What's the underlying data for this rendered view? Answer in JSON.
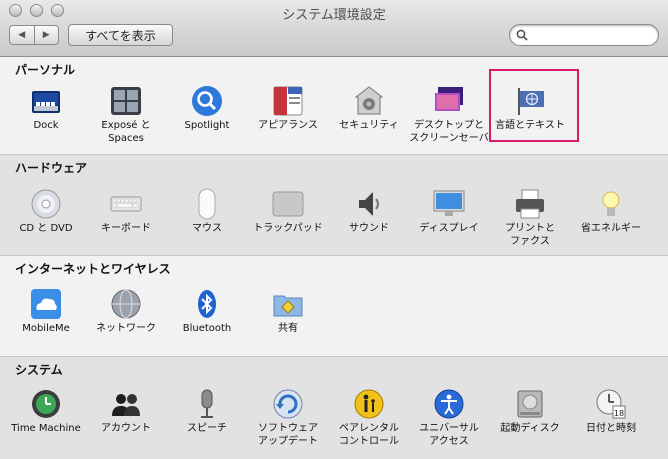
{
  "window": {
    "title": "システム環境設定"
  },
  "toolbar": {
    "back_glyph": "◀",
    "forward_glyph": "▶",
    "show_all": "すべてを表示",
    "search_placeholder": ""
  },
  "sections": {
    "personal": {
      "title": "パーソナル",
      "items": [
        {
          "label": "Dock",
          "icon": "dock-icon"
        },
        {
          "label": "Exposé と\nSpaces",
          "icon": "expose-spaces-icon"
        },
        {
          "label": "Spotlight",
          "icon": "spotlight-icon"
        },
        {
          "label": "アピアランス",
          "icon": "appearance-icon"
        },
        {
          "label": "セキュリティ",
          "icon": "security-icon"
        },
        {
          "label": "デスクトップと\nスクリーンセーバ",
          "icon": "desktop-screensaver-icon"
        },
        {
          "label": "言語とテキスト",
          "icon": "language-text-icon"
        }
      ]
    },
    "hardware": {
      "title": "ハードウェア",
      "items": [
        {
          "label": "CD と DVD",
          "icon": "cd-dvd-icon"
        },
        {
          "label": "キーボード",
          "icon": "keyboard-icon"
        },
        {
          "label": "マウス",
          "icon": "mouse-icon"
        },
        {
          "label": "トラックパッド",
          "icon": "trackpad-icon"
        },
        {
          "label": "サウンド",
          "icon": "sound-icon"
        },
        {
          "label": "ディスプレイ",
          "icon": "display-icon"
        },
        {
          "label": "プリントと\nファクス",
          "icon": "print-fax-icon"
        },
        {
          "label": "省エネルギー",
          "icon": "energy-saver-icon"
        }
      ]
    },
    "internet": {
      "title": "インターネットとワイヤレス",
      "items": [
        {
          "label": "MobileMe",
          "icon": "mobileme-icon"
        },
        {
          "label": "ネットワーク",
          "icon": "network-icon"
        },
        {
          "label": "Bluetooth",
          "icon": "bluetooth-icon"
        },
        {
          "label": "共有",
          "icon": "sharing-icon"
        }
      ]
    },
    "system": {
      "title": "システム",
      "items": [
        {
          "label": "Time Machine",
          "icon": "time-machine-icon"
        },
        {
          "label": "アカウント",
          "icon": "accounts-icon"
        },
        {
          "label": "スピーチ",
          "icon": "speech-icon"
        },
        {
          "label": "ソフトウェア\nアップデート",
          "icon": "software-update-icon"
        },
        {
          "label": "ペアレンタル\nコントロール",
          "icon": "parental-controls-icon"
        },
        {
          "label": "ユニバーサル\nアクセス",
          "icon": "universal-access-icon"
        },
        {
          "label": "起動ディスク",
          "icon": "startup-disk-icon"
        },
        {
          "label": "日付と時刻",
          "icon": "date-time-icon"
        }
      ],
      "date_icon_day": "18"
    }
  },
  "colors": {
    "highlight": "#d91a6a"
  }
}
